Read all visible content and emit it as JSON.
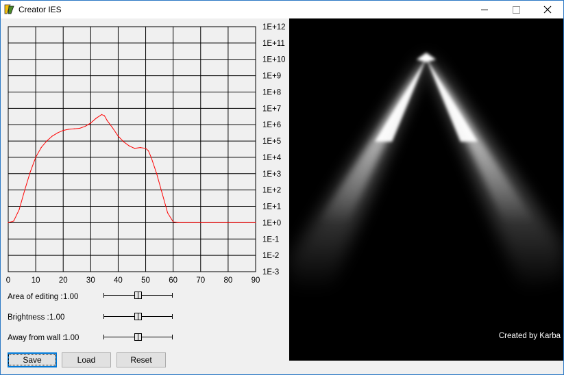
{
  "window": {
    "title": "Creator IES"
  },
  "chart_data": {
    "type": "line",
    "x_ticks": [
      "0",
      "10",
      "20",
      "30",
      "40",
      "50",
      "60",
      "70",
      "80",
      "90"
    ],
    "y_ticks": [
      "1E+12",
      "1E+11",
      "1E+10",
      "1E+9",
      "1E+8",
      "1E+7",
      "1E+6",
      "1E+5",
      "1E+4",
      "1E+3",
      "1E+2",
      "1E+1",
      "1E+0",
      "1E-1",
      "1E-2",
      "1E-3"
    ],
    "xlim": [
      0,
      90
    ],
    "ylim_log10": [
      -3,
      12
    ],
    "y_scale": "log",
    "grid": true,
    "series_color": "#ff0000",
    "x": [
      0,
      2,
      4,
      6,
      8,
      10,
      12,
      14,
      16,
      18,
      20,
      22,
      24,
      26,
      28,
      30,
      32,
      34,
      35,
      36,
      38,
      40,
      42,
      44,
      46,
      48,
      50,
      51,
      52,
      54,
      56,
      58,
      60,
      62,
      70,
      80,
      90
    ],
    "log10_y": [
      0,
      0.1,
      0.8,
      2.0,
      3.1,
      4.0,
      4.6,
      5.0,
      5.3,
      5.5,
      5.65,
      5.72,
      5.75,
      5.78,
      5.9,
      6.1,
      6.4,
      6.62,
      6.55,
      6.25,
      5.8,
      5.3,
      4.95,
      4.7,
      4.55,
      4.6,
      4.55,
      4.4,
      4.0,
      3.0,
      1.8,
      0.6,
      0.05,
      0,
      0,
      0,
      0
    ]
  },
  "controls": {
    "area_label": "Area of editing :",
    "area_value": "1.00",
    "area_level": 0.5,
    "brightness_label": "Brightness :",
    "brightness_value": "1.00",
    "brightness_level": 0.5,
    "wall_label": "Away from wall :",
    "wall_value": "1.00",
    "wall_level": 0.5
  },
  "buttons": {
    "save": "Save",
    "load": "Load",
    "reset": "Reset"
  },
  "preview": {
    "credit": "Created by Karba"
  }
}
